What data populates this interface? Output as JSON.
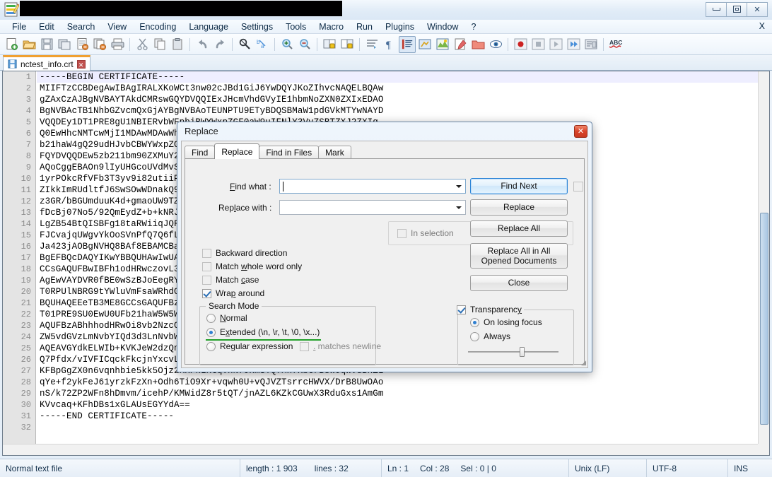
{
  "window": {
    "title_redacted": true,
    "minimize_label": "Minimize",
    "maximize_label": "Restore",
    "close_label": "✕"
  },
  "menubar": {
    "items": [
      "File",
      "Edit",
      "Search",
      "View",
      "Encoding",
      "Language",
      "Settings",
      "Tools",
      "Macro",
      "Run",
      "Plugins",
      "Window",
      "?"
    ],
    "right_x": "X"
  },
  "toolbar": {
    "icons": [
      "new-file-icon",
      "open-file-icon",
      "save-icon",
      "save-all-icon",
      "close-file-icon",
      "close-all-icon",
      "print-icon",
      "cut-icon",
      "copy-icon",
      "paste-icon",
      "undo-icon",
      "redo-icon",
      "find-icon",
      "replace-icon",
      "zoom-in-icon",
      "zoom-out-icon",
      "sync-vertical-scroll-icon",
      "sync-horizontal-scroll-icon",
      "word-wrap-icon",
      "show-all-chars-icon",
      "show-indent-guide-icon",
      "user-defined-dialog-icon",
      "document-map-icon",
      "function-list-icon",
      "folder-as-workspace-icon",
      "monitoring-icon",
      "record-macro-icon",
      "stop-recording-icon",
      "playback-icon",
      "run-macro-multiple-icon",
      "save-macro-icon",
      "spell-check-icon"
    ]
  },
  "tab": {
    "filename": "nctest_info.crt",
    "close_label": "✕"
  },
  "editor": {
    "line_numbers": [
      1,
      2,
      3,
      4,
      5,
      6,
      7,
      8,
      9,
      10,
      11,
      12,
      13,
      14,
      15,
      16,
      17,
      18,
      19,
      20,
      21,
      22,
      23,
      24,
      25,
      26,
      27,
      28,
      29,
      30,
      31,
      32
    ],
    "lines": [
      "-----BEGIN CERTIFICATE-----",
      "MIIFTzCCBDegAwIBAgIRALXKoWCt3nw02cJBd1GiJ6YwDQYJKoZIhvcNAQELBQAw",
      "gZAxCzAJBgNVBAYTAkdCMRswGQYDVQQIExJHcmVhdGVyIE1hbmNoZXN0ZXIxEDAO",
      "BgNVBAcTB1NhbGZvcmQxGjAYBgNVBAoTEUNPTU9ETyBDQSBMaW1pdGVkMTYwNAYD",
      "VQQDEy1DT1PRE8gU1NBIERvbWFpbiBWYWxpZGF0aW9uIFNlY3VyZSBTZXJ2ZXIg",
      "Q0EwHhcNMTcwMjI1MDAwMDAwWhcNMTgwMzI4MjM1OTU5WjBZMSEwHwYDVQQLExhE",
      "b21haW4gQ29udHJvbCBWYWxpZGF0ZWQxHTAbBgNVBAsTFFBvc2l0aXZlU1NMIE11",
      "FQYDVQQDEw5zb211bm90ZXMuY29tMIIBIjANBgkqhkiG9w0BAQEFAAOCAQ8AMIIB",
      "AQoCggEBAOn9lIyUHGcoUVdMvS6mCzF0mqSzBL3z0tFJ2mPqOdQfWqZ6kQxKHDnZ",
      "1yrPOkcRfVFb3T3yv9i82utiiPXm8ZgPJNcSnZFPpqG0oQjEDZm4oBVWMSjTmQsy",
      "ZIkkImRUdltfJ6SwSOwWDnakQ9lBRnBBQGm1dTLJmEBhgRaKAYpLMhMcMYdFwDnV",
      "z3GR/bBGUmduuK4d+gmaoUW9TZvEyQg1zXjPvqNBFCN1zGbJqCkU9xVLmGWn1xRG",
      "fDcBj07No5/92QmEydZ+b+kNRJpqYmZPYOWJdgJKpXfKOkeJnKbW8qRfFBYSbHM1",
      "LgZB54BtQISBFg18taRWiiqJQFDPYBhXdmtJQ7xCWWmKmZ8qYFJMbVGgXtBvxRtB",
      "FJCvajqUWgvYkOoSVnPfQ7Q6fLJRmZMPaXgGHVfXyKGEaQbTbWmXaRUqNgwKJfZh",
      "Ja423jAOBgNVHQ8BAf8EBAMCBaAwHQYDVR0lBBYwFAYIKwYBBQUHAwEGCCsGAQUF",
      "BgEFBQcDAQYIKwYBBQUHAwIwUAYDVR0gBEkwRzA7BgwrBgEEAbIxAQIBAwQwKzAp",
      "CCsGAQUFBwIBFh1odHRwczovL3NlY3VyZS5jb21vZG8uY29tL0NQUzAIBgZngQwB",
      "AgEwVAYDVR0fBE0wSzBJoEegRYZDaHR0cDovL2NybC5jb21vZG9jYS5jb20vQ09N",
      "T0RPUlNBRG9tYWluVmFsaWRhdGlvblNlY3VyZVNlcnZlckNBLmNybDCBhQYIKwYB",
      "BQUHAQEEeTB3ME8GCCsGAQUFBzAChkNodHRwOi8vY3J0LmNvbW9kb2NhLmNvbS9D",
      "T01PRE9SU0EwU0UFb21haW5W5WYWxpZGF0aW9uU2VjdXJlU2VydmVyQ0EuY3J0",
      "AQUFBzABhhhodHRwOi8vb2NzcC5jb21vZG9jYS5jb20wKQYDVR0RBCIwIIIOc29t",
      "ZW5vdGVzLmNvbYIQd3d3LnNvbWVub3Rlcy5jb20wDQYJKoZIhvcNAQELBQADggEB",
      "AQEAVGYdkELWIb+KVKJeW2dzQnVB0hbCRZqLRQDMJ1NaOhMZFKfQXgCVZlLnTnJr",
      "Q7Pfdx/vIVFICqckFkcjnYxcvLdbFHmTWKuZnXoLtJCKBzPqsHMvGXqYWtKzLYFJ",
      "KFBpGgZX0n6vqnhbie5kk5Ojz2KRPkLRtqVnNfJxmSTQfMhfRbCrBsWJqWvdBnZL",
      "qYe+f2ykFeJ61yrzkFzXn+Odh6TiO9Xr+vqwh0U+vQJVZTsrrcHWVX/DrB8UwOAo",
      "nS/k72ZP2WFn8hDmvm/icehP/KMWidZ8r5tQT/jnAZL6KZkCGUwX3RduGxs1AmGm",
      "KVvcaq+KFhDBs1xGLAUsEGYYdA==",
      "-----END CERTIFICATE-----",
      ""
    ]
  },
  "statusbar": {
    "file_type": "Normal text file",
    "length_label": "length : 1 903",
    "lines_label": "lines : 32",
    "ln": "Ln : 1",
    "col": "Col : 28",
    "sel": "Sel : 0 | 0",
    "eol": "Unix (LF)",
    "encoding": "UTF-8",
    "insert_mode": "INS"
  },
  "dialog": {
    "title": "Replace",
    "close_label": "✕",
    "tabs": [
      {
        "label": "Find",
        "active": false
      },
      {
        "label": "Replace",
        "active": true
      },
      {
        "label": "Find in Files",
        "active": false
      },
      {
        "label": "Mark",
        "active": false
      }
    ],
    "find_what_label": "Find what :",
    "find_what_value": "",
    "replace_with_label": "Replace with :",
    "replace_with_value": "",
    "buttons": {
      "find_next": "Find Next",
      "replace": "Replace",
      "replace_all": "Replace All",
      "replace_all_opened": "Replace All in All Opened Documents",
      "close": "Close"
    },
    "in_selection": {
      "label": "In selection",
      "checked": false,
      "enabled": false
    },
    "options": [
      {
        "label": "Backward direction",
        "checked": false
      },
      {
        "label": "Match whole word only",
        "checked": false
      },
      {
        "label": "Match case",
        "checked": false
      },
      {
        "label": "Wrap around",
        "checked": true
      }
    ],
    "search_mode": {
      "legend": "Search Mode",
      "items": [
        {
          "label": "Normal",
          "selected": false
        },
        {
          "label": "Extended (\\n, \\r, \\t, \\0, \\x...)",
          "selected": true,
          "highlighted": true
        },
        {
          "label": "Regular expression",
          "selected": false
        }
      ],
      "dot_matches_newline": {
        "label": ". matches newline",
        "checked": false,
        "enabled": false
      }
    },
    "transparency": {
      "label": "Transparency",
      "checked": true,
      "items": [
        {
          "label": "On losing focus",
          "selected": true
        },
        {
          "label": "Always",
          "selected": false
        }
      ],
      "slider_percent": 60
    },
    "highlight_color": "#22a02a"
  }
}
